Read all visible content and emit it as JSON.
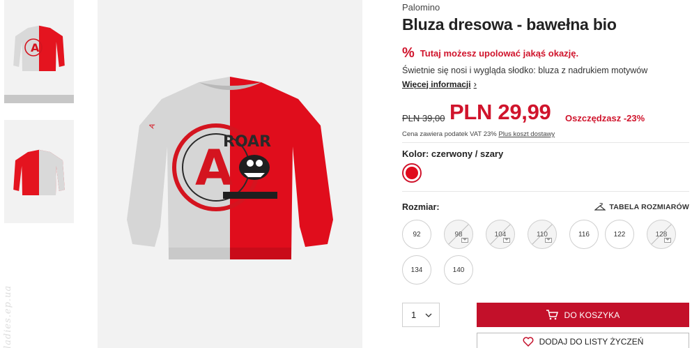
{
  "thumbnails": [
    {
      "icon": "sweatshirt-front-thumbnail"
    },
    {
      "icon": "sweatshirt-back-thumbnail"
    }
  ],
  "watermark": "ladies.ep.ua",
  "product": {
    "brand": "Palomino",
    "title": "Bluza dresowa - bawełna bio",
    "deal_icon": "%",
    "deal_text": "Tutaj możesz upolować jakąś okazję.",
    "description": "Świetnie się nosi i wygląda słodko: bluza z nadrukiem motywów",
    "more_info": "Więcej informacji",
    "old_price": "PLN 39,00",
    "new_price": "PLN 29,99",
    "savings": "Oszczędzasz -23%",
    "tax_note": "Cena zawiera podatek VAT 23%",
    "shipping_link": "Plus koszt dostawy",
    "color_label": "Kolor: czerwony / szary",
    "color_swatch": "#e00a1c",
    "size_label": "Rozmiar:",
    "size_table": "TABELA ROZMIARÓW",
    "sizes": [
      {
        "label": "92",
        "available": true
      },
      {
        "label": "98",
        "available": false
      },
      {
        "label": "104",
        "available": false
      },
      {
        "label": "110",
        "available": false
      },
      {
        "label": "116",
        "available": true
      },
      {
        "label": "122",
        "available": true
      },
      {
        "label": "128",
        "available": false
      },
      {
        "label": "134",
        "available": true
      },
      {
        "label": "140",
        "available": true
      }
    ],
    "quantity": "1",
    "add_to_cart": "DO KOSZYKA",
    "add_to_wishlist": "DODAJ DO LISTY ŻYCZEŃ"
  },
  "colors": {
    "accent": "#d0142c",
    "button": "#c3102a",
    "image_bg": "#f2f2f2"
  }
}
